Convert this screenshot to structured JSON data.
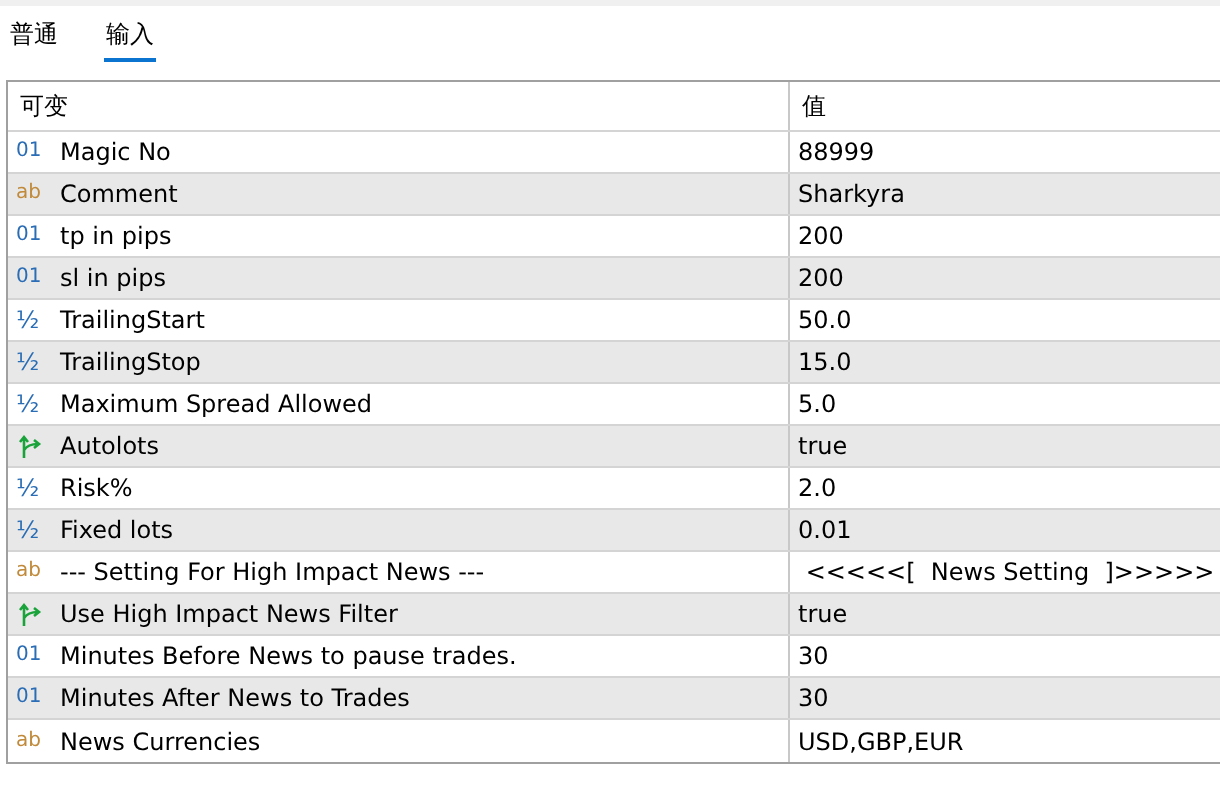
{
  "tabs": [
    {
      "label": "普通",
      "selected": false
    },
    {
      "label": "输入",
      "selected": true
    }
  ],
  "table": {
    "columns": [
      "可变",
      "值"
    ],
    "rows": [
      {
        "kind": "int",
        "icon": "01",
        "name": "Magic No",
        "value": "88999"
      },
      {
        "kind": "string",
        "icon": "ab",
        "name": "Comment",
        "value": "Sharkyra"
      },
      {
        "kind": "int",
        "icon": "01",
        "name": "tp in pips",
        "value": "200"
      },
      {
        "kind": "int",
        "icon": "01",
        "name": "sl in pips",
        "value": "200"
      },
      {
        "kind": "double",
        "icon": "½",
        "name": "TrailingStart",
        "value": "50.0"
      },
      {
        "kind": "double",
        "icon": "½",
        "name": "TrailingStop",
        "value": "15.0"
      },
      {
        "kind": "double",
        "icon": "½",
        "name": "Maximum Spread Allowed",
        "value": "5.0"
      },
      {
        "kind": "bool",
        "name": "Autolots",
        "value": "true"
      },
      {
        "kind": "double",
        "icon": "½",
        "name": "Risk%",
        "value": "2.0"
      },
      {
        "kind": "double",
        "icon": "½",
        "name": "Fixed lots",
        "value": "0.01"
      },
      {
        "kind": "string",
        "icon": "ab",
        "name": "--- Setting For High Impact News ---",
        "value": " <<<<<[  News Setting  ]>>>>>"
      },
      {
        "kind": "bool",
        "name": "Use High Impact News Filter",
        "value": "true"
      },
      {
        "kind": "int",
        "icon": "01",
        "name": "Minutes Before News to pause trades.",
        "value": "30"
      },
      {
        "kind": "int",
        "icon": "01",
        "name": "Minutes After News to Trades",
        "value": "30"
      },
      {
        "kind": "string",
        "icon": "ab",
        "name": "News Currencies",
        "value": "USD,GBP,EUR"
      }
    ]
  }
}
